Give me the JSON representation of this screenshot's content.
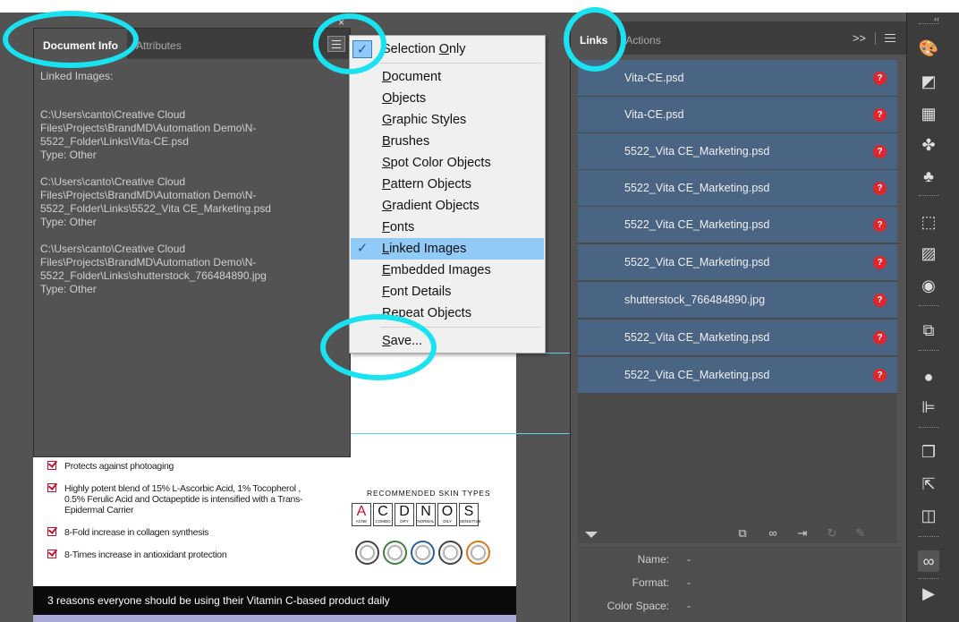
{
  "document_info_panel": {
    "tabs": [
      {
        "label": "Document Info",
        "active": true
      },
      {
        "label": "Attributes",
        "active": false
      }
    ],
    "close_label": "×",
    "heading": "Linked Images:",
    "entries": [
      {
        "path": "C:\\Users\\canto\\Creative Cloud Files\\Projects\\BrandMD\\Automation Demo\\N-5522_Folder\\Links\\Vita-CE.psd",
        "type": "Type: Other"
      },
      {
        "path": "C:\\Users\\canto\\Creative Cloud Files\\Projects\\BrandMD\\Automation Demo\\N-5522_Folder\\Links\\5522_Vita CE_Marketing.psd",
        "type": "Type: Other"
      },
      {
        "path": "C:\\Users\\canto\\Creative Cloud Files\\Projects\\BrandMD\\Automation Demo\\N-5522_Folder\\Links\\shutterstock_766484890.jpg",
        "type": "Type: Other"
      }
    ]
  },
  "flyout_menu": {
    "items": [
      {
        "label_pre": "S",
        "label_u": "",
        "label_post": "election ",
        "label_u2": "O",
        "label_post2": "nly",
        "checked": true
      },
      {
        "label_pre": "",
        "label_u": "D",
        "label_post": "ocument",
        "checked": false
      },
      {
        "label_pre": "",
        "label_u": "O",
        "label_post": "bjects",
        "checked": false
      },
      {
        "label_pre": "",
        "label_u": "G",
        "label_post": "raphic Styles",
        "checked": false
      },
      {
        "label_pre": "",
        "label_u": "B",
        "label_post": "rushes",
        "checked": false
      },
      {
        "label_pre": "",
        "label_u": "S",
        "label_post": "pot Color Objects",
        "checked": false
      },
      {
        "label_pre": "",
        "label_u": "P",
        "label_post": "attern Objects",
        "checked": false
      },
      {
        "label_pre": "",
        "label_u": "G",
        "label_post": "radient Objects",
        "checked": false
      },
      {
        "label_pre": "",
        "label_u": "F",
        "label_post": "onts",
        "checked": false
      },
      {
        "label_pre": "",
        "label_u": "L",
        "label_post": "inked Images",
        "checked": true
      },
      {
        "label_pre": "",
        "label_u": "E",
        "label_post": "mbedded Images",
        "checked": false
      },
      {
        "label_pre": "",
        "label_u": "F",
        "label_post": "ont Details",
        "checked": false
      },
      {
        "label_pre": "",
        "label_u": "R",
        "label_post": "epeat Objects",
        "checked": false
      },
      {
        "label_pre": "",
        "label_u": "S",
        "label_post": "ave...",
        "checked": false
      }
    ],
    "check_glyph": "✓"
  },
  "links_panel": {
    "tabs": [
      {
        "label": "Links",
        "active": true
      },
      {
        "label": "Actions",
        "active": false
      }
    ],
    "expand_label": ">>",
    "items": [
      {
        "name": "Vita-CE.psd",
        "status": "missing"
      },
      {
        "name": "Vita-CE.psd",
        "status": "missing"
      },
      {
        "name": "5522_Vita CE_Marketing.psd",
        "status": "missing"
      },
      {
        "name": "5522_Vita CE_Marketing.psd",
        "status": "missing"
      },
      {
        "name": "5522_Vita CE_Marketing.psd",
        "status": "missing"
      },
      {
        "name": "5522_Vita CE_Marketing.psd",
        "status": "missing"
      },
      {
        "name": "shutterstock_766484890.jpg",
        "status": "missing"
      },
      {
        "name": "5522_Vita CE_Marketing.psd",
        "status": "missing"
      },
      {
        "name": "5522_Vita CE_Marketing.psd",
        "status": "missing"
      }
    ],
    "warning_glyph": "?",
    "info": [
      {
        "label": "Name:",
        "value": "-"
      },
      {
        "label": "Format:",
        "value": "-"
      },
      {
        "label": "Color Space:",
        "value": "-"
      }
    ],
    "toolbar_icons": [
      "show-link-info-icon",
      "relink-icon",
      "go-to-link-icon",
      "place-icon",
      "update-link-icon",
      "edit-original-icon"
    ]
  },
  "artboard": {
    "benefits": [
      "Protects against photoaging",
      "Highly potent blend of 15% L-Ascorbic Acid, 1% Tocopherol , 0.5% Ferulic Acid and Octapeptide is intensified with a Trans-Epidermal Carrier",
      "8-Fold increase in collagen synthesis",
      "8-Times increase in antioxidant protection"
    ],
    "skin_types_title": "RECOMMENDED SKIN TYPES",
    "skin_types": [
      {
        "letter": "A",
        "label": "ACNE"
      },
      {
        "letter": "C",
        "label": "COMBO"
      },
      {
        "letter": "D",
        "label": "DRY"
      },
      {
        "letter": "N",
        "label": "NORMAL"
      },
      {
        "letter": "O",
        "label": "OILY"
      },
      {
        "letter": "S",
        "label": "SENSITIVE"
      }
    ],
    "banner_text": "3 reasons everyone should be using their Vitamin C-based product daily"
  },
  "dock": {
    "collapse_label": "‹‹",
    "icons": [
      "color-palette-icon",
      "color-guide-icon",
      "swatches-icon",
      "brushes-icon",
      "symbols-icon",
      "transform-icon",
      "gradient-icon",
      "stroke-icon",
      "transparency-icon",
      "appearance-icon",
      "align-icon",
      "pathfinder-icon",
      "export-icon",
      "layers-icon",
      "links-icon",
      "actions-play-icon"
    ]
  },
  "colors": {
    "annotation": "#19e3f0",
    "link_row": "#4a6484",
    "warning": "#e0262c",
    "menu_highlight": "#91c9f7"
  }
}
